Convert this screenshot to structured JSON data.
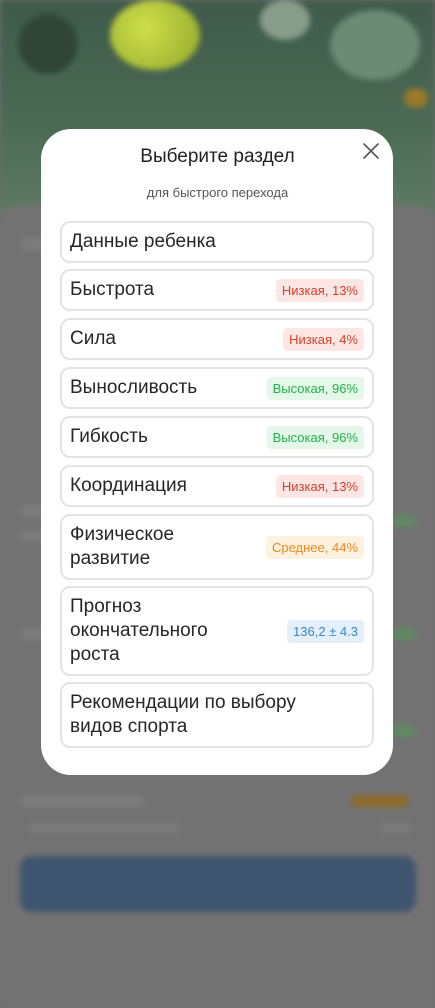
{
  "modal": {
    "title": "Выберите раздел",
    "subtitle": "для быстрого перехода",
    "close_icon": "close-icon",
    "sections": [
      {
        "label": "Данные ребенка",
        "badge": null
      },
      {
        "label": "Быстрота",
        "badge": "Низкая, 13%",
        "level": "low"
      },
      {
        "label": "Сила",
        "badge": "Низкая, 4%",
        "level": "low"
      },
      {
        "label": "Выносливость",
        "badge": "Высокая, 96%",
        "level": "high"
      },
      {
        "label": "Гибкость",
        "badge": "Высокая, 96%",
        "level": "high"
      },
      {
        "label": "Координация",
        "badge": "Низкая, 13%",
        "level": "low"
      },
      {
        "label": "Физическое\nразвитие",
        "badge": "Среднее, 44%",
        "level": "mid"
      },
      {
        "label": "Прогноз\nокончательного\nроста",
        "badge": "136,2 ± 4.3",
        "level": "info"
      },
      {
        "label": "Рекомендации по выбору\nвидов спорта",
        "badge": null
      }
    ]
  },
  "colors": {
    "low": "#d8402f",
    "high": "#23b34a",
    "mid": "#ee8a1e",
    "info": "#3b86c8"
  }
}
